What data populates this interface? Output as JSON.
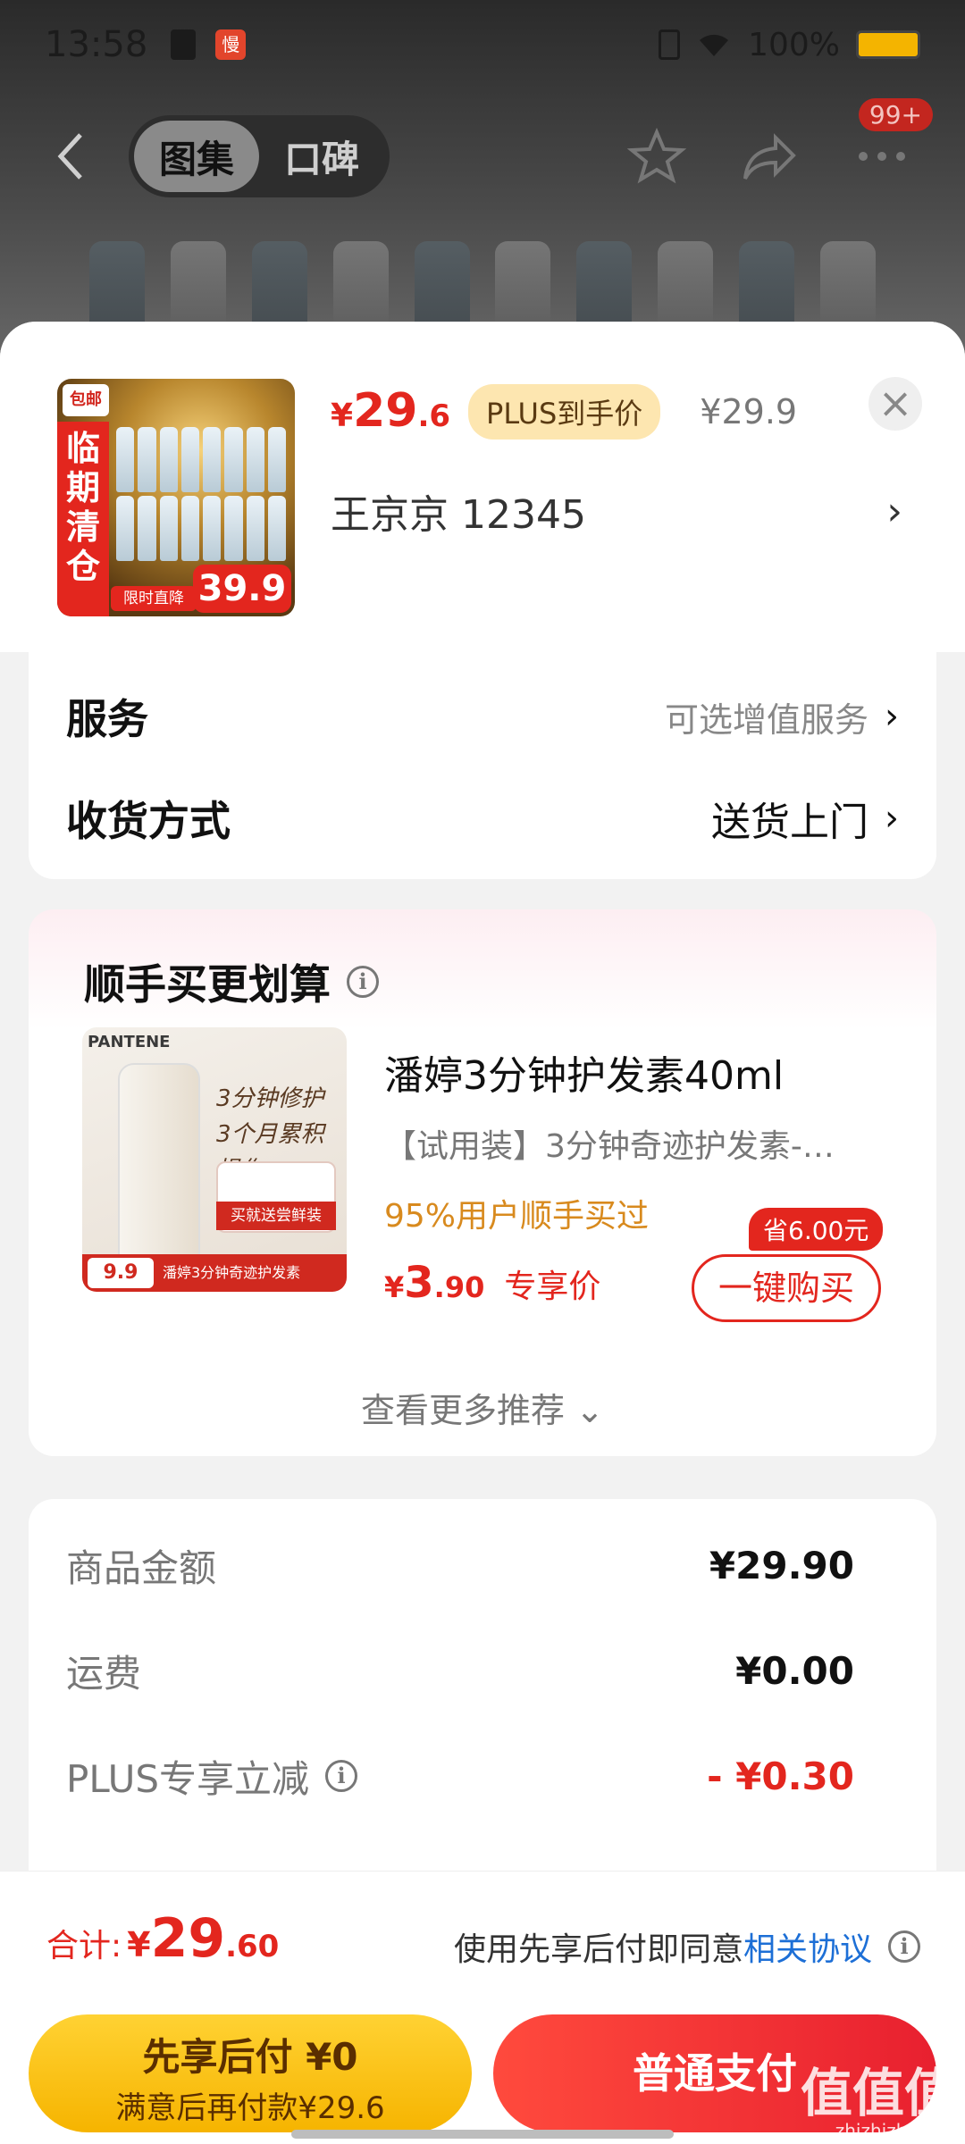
{
  "status": {
    "time": "13:58",
    "app_badge": "慢",
    "battery": "100%"
  },
  "nav": {
    "tabs": [
      "图集",
      "口碑"
    ],
    "badge": "99+"
  },
  "product": {
    "image_tag": "包邮",
    "image_side_text": "临期清仓",
    "image_price": "39.9",
    "image_strip": "限时直降",
    "price_symbol": "¥",
    "price_int": "29",
    "price_dec": ".6",
    "plus_label": "PLUS到手价",
    "original_price": "¥29.9",
    "address": "王京京  12345"
  },
  "service": {
    "row1_label": "服务",
    "row1_value": "可选增值服务",
    "row2_label": "收货方式",
    "row2_value": "送货上门"
  },
  "recommend": {
    "title": "顺手买更划算",
    "name": "潘婷3分钟护发素40ml",
    "desc": "【试用装】3分钟奇迹护发素-…",
    "bought": "95%用户顺手买过",
    "price_symbol": "¥",
    "price_int": "3",
    "price_dec": ".90",
    "price_label": "专享价",
    "save_tag": "省6.00元",
    "buy_button": "一键购买",
    "more": "查看更多推荐",
    "img_brand": "PANTENE",
    "img_line1": "3分钟修护",
    "img_line2": "3个月累积损伤",
    "img_red": "买就送尝鲜装",
    "img_price": "9.9",
    "img_bottom": "潘婷3分钟奇迹护发素"
  },
  "summary": {
    "row1_label": "商品金额",
    "row1_value": "¥29.90",
    "row2_label": "运费",
    "row2_value": "¥0.00",
    "row3_label": "PLUS专享立减",
    "row3_value": "- ¥0.30"
  },
  "bottom": {
    "total_label": "合计:",
    "total_symbol": "¥",
    "total_int": "29",
    "total_dec": ".60",
    "agree_text": "使用先享后付即同意",
    "agree_link": "相关协议",
    "later_line1": "先享后付 ¥0",
    "later_line2": "满意后再付款¥29.6",
    "normal_pay": "普通支付",
    "watermark": "值值值",
    "watermark_sub": "zhizhizhi.com"
  }
}
